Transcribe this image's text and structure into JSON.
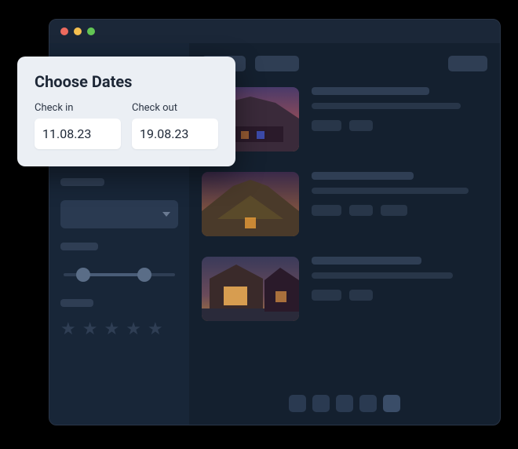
{
  "date_picker": {
    "title": "Choose Dates",
    "check_in_label": "Check in",
    "check_out_label": "Check out",
    "check_in_value": "11.08.23",
    "check_out_value": "19.08.23"
  },
  "colors": {
    "window_bg": "#14202f",
    "sidebar_bg": "#182638",
    "card_bg": "#ebeff4"
  }
}
